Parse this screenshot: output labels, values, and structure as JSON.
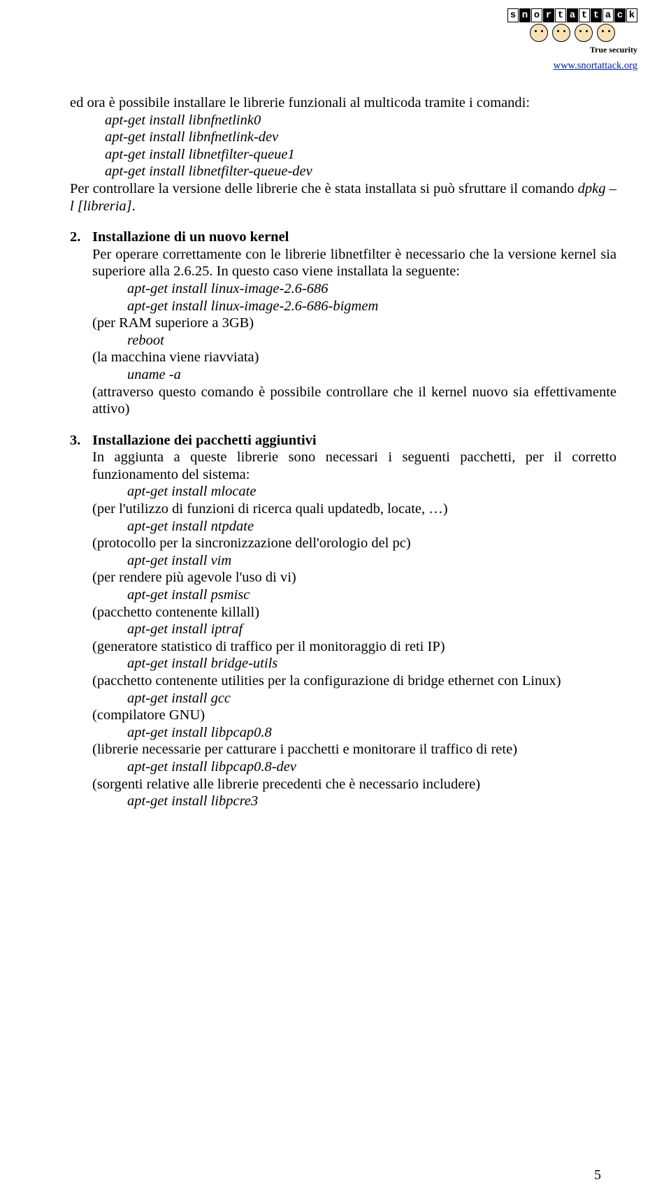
{
  "header": {
    "logo_letters": [
      "s",
      "n",
      "o",
      "r",
      "t",
      "a",
      "t",
      "t",
      "a",
      "c",
      "k"
    ],
    "logo_tagline": "True security",
    "url": "www.snortattack.org"
  },
  "intro": {
    "line1": "ed ora è possibile installare le librerie funzionali al multicoda tramite i comandi:",
    "cmd1": "apt-get install libnfnetlink0",
    "cmd2": "apt-get install libnfnetlink-dev",
    "cmd3": "apt-get install libnetfilter-queue1",
    "cmd4": "apt-get install libnetfilter-queue-dev",
    "line2a": "Per controllare la versione delle librerie che è stata installata si può sfruttare il comando ",
    "line2b": "dpkg –l [libreria]",
    "line2c": "."
  },
  "sec2": {
    "num": "2.",
    "title": "Installazione di un nuovo kernel",
    "p1": "Per operare correttamente con le librerie libnetfilter è necessario che la versione kernel sia superiore alla 2.6.25. In questo caso viene installata la seguente:",
    "cmd1": "apt-get install linux-image-2.6-686",
    "cmd2": "apt-get install linux-image-2.6-686-bigmem",
    "note1": "(per RAM superiore a 3GB)",
    "cmd3": "reboot",
    "note2": "(la macchina viene riavviata)",
    "cmd4": "uname -a",
    "note3": "(attraverso questo comando è possibile controllare che il kernel nuovo sia effettivamente attivo)"
  },
  "sec3": {
    "num": "3.",
    "title": "Installazione dei pacchetti aggiuntivi",
    "p1": "In aggiunta a queste librerie sono necessari i seguenti pacchetti, per il corretto funzionamento del sistema:",
    "cmd1": "apt-get install mlocate",
    "note1": "(per l'utilizzo di funzioni di ricerca quali updatedb, locate, …)",
    "cmd2": "apt-get install ntpdate",
    "note2": "(protocollo per la sincronizzazione dell'orologio del pc)",
    "cmd3": "apt-get install vim",
    "note3": "(per rendere più agevole l'uso di vi)",
    "cmd4": "apt-get install psmisc",
    "note4": "(pacchetto contenente killall)",
    "cmd5": "apt-get install iptraf",
    "note5": "(generatore statistico di traffico per il monitoraggio di reti IP)",
    "cmd6": "apt-get install bridge-utils",
    "note6": "(pacchetto contenente utilities per la configurazione di bridge ethernet con Linux)",
    "cmd7": "apt-get install gcc",
    "note7": "(compilatore GNU)",
    "cmd8": "apt-get install libpcap0.8",
    "note8": "(librerie necessarie per catturare i pacchetti e monitorare il traffico di rete)",
    "cmd9": "apt-get install libpcap0.8-dev",
    "note9": "(sorgenti relative alle librerie precedenti che è necessario includere)",
    "cmd10": "apt-get install libpcre3"
  },
  "pagenum": "5"
}
